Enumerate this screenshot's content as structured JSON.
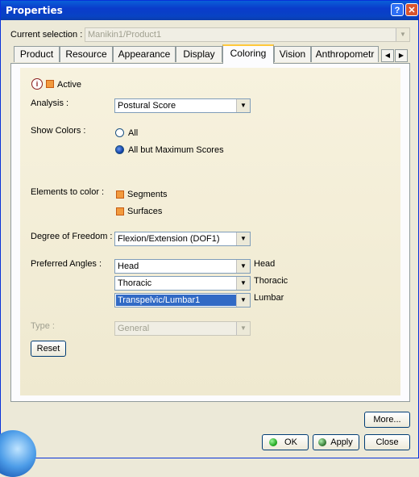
{
  "window": {
    "title": "Properties",
    "help_glyph": "?",
    "close_glyph": "✕"
  },
  "selection": {
    "label": "Current selection :",
    "value": "Manikin1/Product1"
  },
  "tabs": [
    {
      "label": "Product"
    },
    {
      "label": "Resource"
    },
    {
      "label": "Appearance"
    },
    {
      "label": "Display"
    },
    {
      "label": "Coloring"
    },
    {
      "label": "Vision"
    },
    {
      "label": "Anthropometr"
    }
  ],
  "active_tab": "Coloring",
  "coloring": {
    "info_glyph": "i",
    "active_label": "Active",
    "analysis": {
      "label": "Analysis :",
      "value": "Postural Score"
    },
    "show_colors": {
      "label": "Show Colors :",
      "options": [
        "All",
        "All but Maximum Scores"
      ],
      "selected": "All but Maximum Scores"
    },
    "elements": {
      "label": "Elements to color :",
      "segments": "Segments",
      "surfaces": "Surfaces"
    },
    "dof": {
      "label": "Degree of Freedom :",
      "value": "Flexion/Extension (DOF1)"
    },
    "angles": {
      "label": "Preferred Angles :",
      "rows": [
        {
          "value": "Head",
          "tag": "Head"
        },
        {
          "value": "Thoracic",
          "tag": "Thoracic"
        },
        {
          "value": "Transpelvic/Lumbar1",
          "tag": "Lumbar"
        }
      ]
    },
    "type": {
      "label": "Type :",
      "value": "General"
    },
    "reset_label": "Reset"
  },
  "footer": {
    "more_label": "More...",
    "ok_label": "OK",
    "apply_label": "Apply",
    "close_label": "Close"
  },
  "colors": {
    "title_bar": "#0a3bcb",
    "checkbox": "#f29a3d",
    "selection": "#316ac5",
    "panel_bg": "#f7f2de"
  }
}
